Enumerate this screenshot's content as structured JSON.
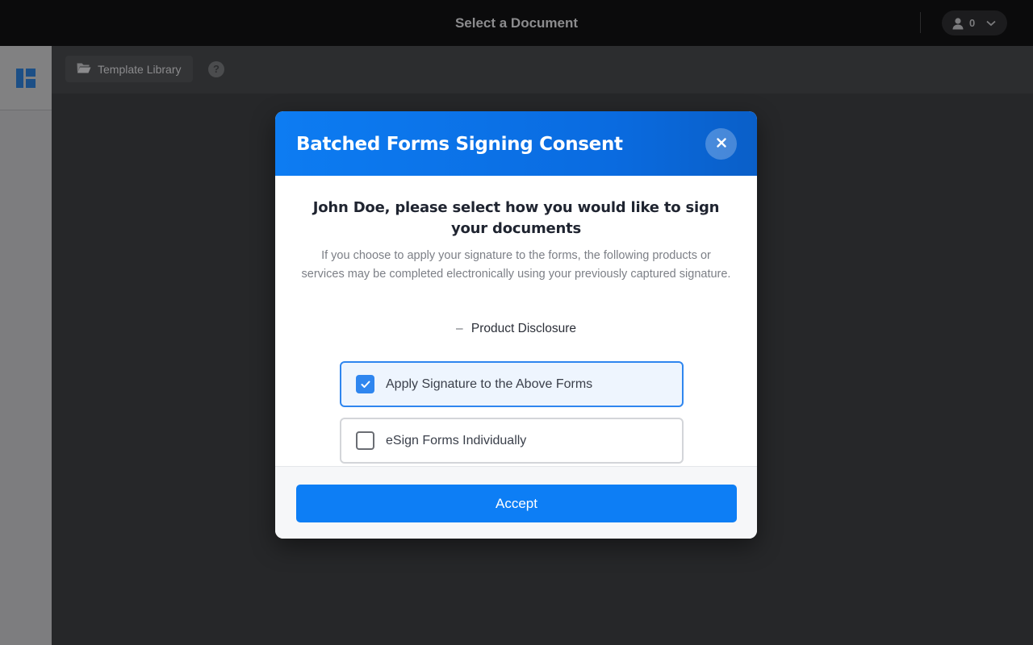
{
  "topbar": {
    "title": "Select a Document",
    "user_count": "0",
    "user_icon": "user-icon",
    "dropdown_icon": "chevron-down-icon"
  },
  "sidebar": {
    "logo_icon": "app-logo-icon"
  },
  "toolbar": {
    "template_library_label": "Template Library",
    "template_library_icon": "folder-open-icon",
    "help_label": "?"
  },
  "modal": {
    "title": "Batched Forms Signing Consent",
    "close_icon": "close-icon",
    "prompt": "John Doe, please select how you would like to sign your documents",
    "explanation": "If you choose to apply your signature to the forms, the following products or services may be completed electronically using your previously captured signature.",
    "disclosure_dash": "–",
    "disclosure_item": "Product Disclosure",
    "options": [
      {
        "label": "Apply Signature to the Above Forms",
        "checked": true
      },
      {
        "label": "eSign Forms Individually",
        "checked": false
      }
    ],
    "accept_label": "Accept"
  },
  "colors": {
    "accent": "#0d7ef5",
    "header_gradient_start": "#0d7cf2",
    "header_gradient_end": "#0a5fc8",
    "selected_option_bg": "#eef5fe",
    "selected_option_border": "#2f86ef"
  }
}
